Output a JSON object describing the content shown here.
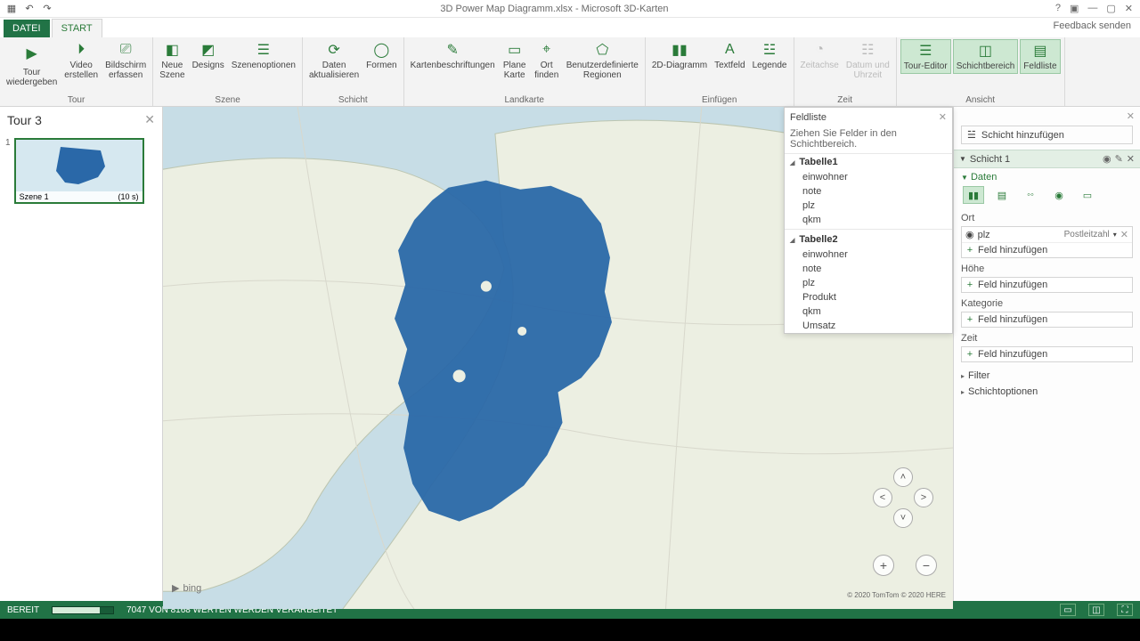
{
  "title": "3D Power Map Diagramm.xlsx - Microsoft 3D-Karten",
  "feedback": "Feedback senden",
  "tabs": {
    "file": "DATEI",
    "start": "START"
  },
  "ribbon": {
    "groups": {
      "tour": {
        "label": "Tour",
        "play": "Tour\nwiedergeben",
        "video": "Video\nerstellen",
        "capture": "Bildschirm\nerfassen"
      },
      "szene": {
        "label": "Szene",
        "neue": "Neue\nSzene",
        "designs": "Designs",
        "optionen": "Szenenoptionen"
      },
      "schicht": {
        "label": "Schicht",
        "daten": "Daten\naktualisieren",
        "formen": "Formen"
      },
      "landkarte": {
        "label": "Landkarte",
        "beschr": "Kartenbeschriftungen",
        "plane": "Plane\nKarte",
        "ort": "Ort\nfinden",
        "regionen": "Benutzerdefinierte\nRegionen"
      },
      "einfuegen": {
        "label": "Einfügen",
        "diagram2d": "2D-Diagramm",
        "textfeld": "Textfeld",
        "legende": "Legende"
      },
      "zeit": {
        "label": "Zeit",
        "achse": "Zeitachse",
        "datum": "Datum und\nUhrzeit"
      },
      "ansicht": {
        "label": "Ansicht",
        "editor": "Tour-Editor",
        "schichtb": "Schichtbereich",
        "feldliste": "Feldliste"
      }
    }
  },
  "tourpanel": {
    "title": "Tour 3",
    "scene_num": "1",
    "scene_label": "Szene 1",
    "scene_dur": "(10 s)"
  },
  "map": {
    "bing": "bing",
    "attrib": "© 2020 TomTom © 2020 HERE"
  },
  "feldliste": {
    "title": "Feldliste",
    "desc": "Ziehen Sie Felder in den Schichtbereich.",
    "tables": [
      {
        "name": "Tabelle1",
        "fields": [
          "einwohner",
          "note",
          "plz",
          "qkm"
        ]
      },
      {
        "name": "Tabelle2",
        "fields": [
          "einwohner",
          "note",
          "plz",
          "Produkt",
          "qkm",
          "Umsatz"
        ]
      }
    ]
  },
  "rpanel": {
    "addlayer": "Schicht hinzufügen",
    "layer_name": "Schicht 1",
    "daten": "Daten",
    "ort": "Ort",
    "ort_field": "plz",
    "ort_type": "Postleitzahl",
    "add_field": "Feld hinzufügen",
    "hoehe": "Höhe",
    "kategorie": "Kategorie",
    "zeit": "Zeit",
    "filter": "Filter",
    "schichtopt": "Schichtoptionen"
  },
  "status": {
    "ready": "BEREIT",
    "progress": "7047 VON 8168 WERTEN WERDEN VERARBEITET"
  }
}
